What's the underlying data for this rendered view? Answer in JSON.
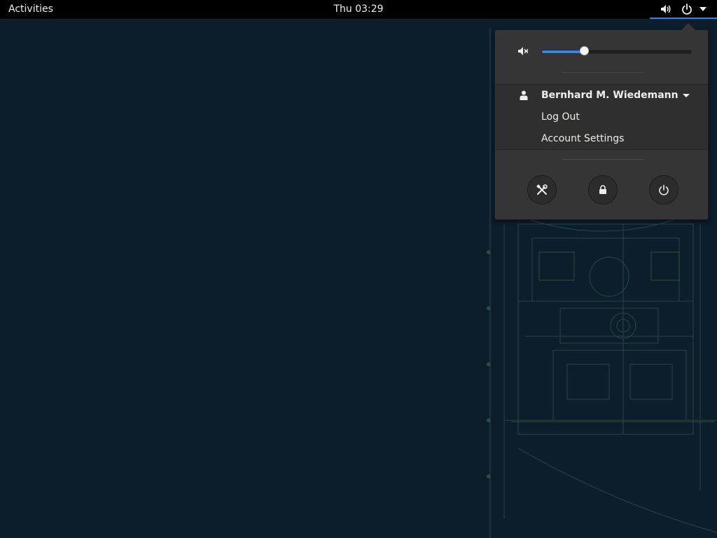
{
  "topbar": {
    "activities_label": "Activities",
    "clock": "Thu 03:29",
    "status_icons": [
      "volume-icon",
      "power-icon",
      "dropdown-arrow-icon"
    ]
  },
  "system_menu": {
    "volume": {
      "icon": "volume-muted-icon",
      "level_fraction": 0.29
    },
    "user": {
      "icon": "user-icon",
      "name": "Bernhard M. Wiedemann",
      "expand_icon": "chevron-down-icon",
      "items": [
        "Log Out",
        "Account Settings"
      ]
    },
    "actions": [
      {
        "icon": "settings-tools-icon"
      },
      {
        "icon": "lock-icon"
      },
      {
        "icon": "power-off-icon"
      }
    ]
  },
  "colors": {
    "accent": "#3584e4",
    "menu_bg": "#353535",
    "topbar_bg": "#000000",
    "desktop_bg": "#0c1d2c"
  }
}
